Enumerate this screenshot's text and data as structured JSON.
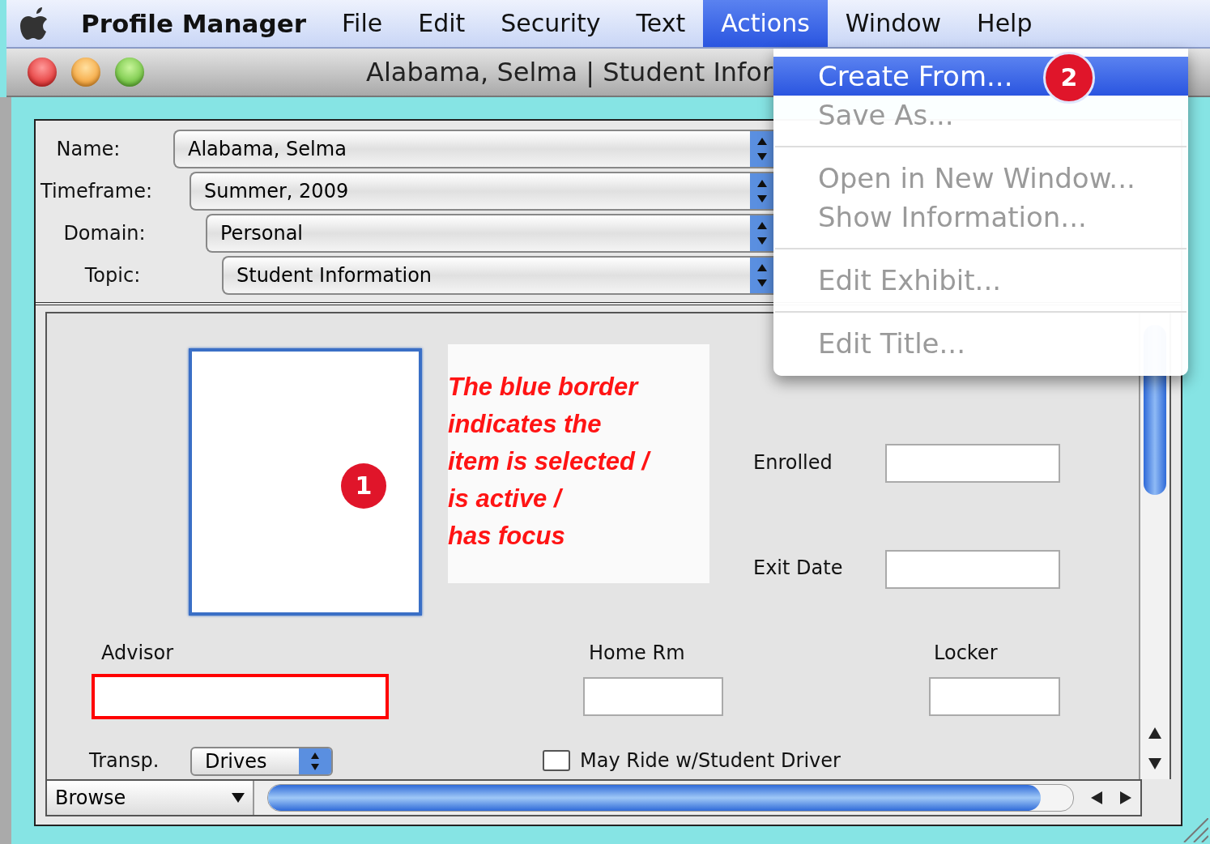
{
  "menu_bar": {
    "app_name": "Profile Manager",
    "items": [
      {
        "label": "File",
        "selected": false
      },
      {
        "label": "Edit",
        "selected": false
      },
      {
        "label": "Security",
        "selected": false
      },
      {
        "label": "Text",
        "selected": false
      },
      {
        "label": "Actions",
        "selected": true
      },
      {
        "label": "Window",
        "selected": false
      },
      {
        "label": "Help",
        "selected": false
      }
    ]
  },
  "window": {
    "title": "Alabama, Selma | Student Infor"
  },
  "header_fields": [
    {
      "label": "Name:",
      "value": "Alabama, Selma"
    },
    {
      "label": "Timeframe:",
      "value": "Summer, 2009"
    },
    {
      "label": "Domain:",
      "value": "Personal"
    },
    {
      "label": "Topic:",
      "value": "Student Information"
    }
  ],
  "photo_box": {
    "selected": true
  },
  "annotation": "The blue border\nindicates the\nitem is selected /\nis active /\nhas focus",
  "callouts": [
    "1",
    "2"
  ],
  "fields": [
    {
      "label": "Enrolled",
      "highlighted": false
    },
    {
      "label": "Exit Date",
      "highlighted": false
    },
    {
      "label": "Advisor",
      "highlighted": true
    },
    {
      "label": "Home Rm",
      "highlighted": false
    },
    {
      "label": "Locker",
      "highlighted": false
    }
  ],
  "transport": {
    "label": "Transp.",
    "value": "Drives"
  },
  "checkbox": {
    "label": "May Ride w/Student Driver",
    "checked": false
  },
  "mode_menu": {
    "value": "Browse"
  },
  "actions_menu": {
    "items": [
      {
        "kind": "item",
        "label": "Create From...",
        "selected": true,
        "disabled": false
      },
      {
        "kind": "item",
        "label": "Save As...",
        "selected": false,
        "disabled": true
      },
      {
        "kind": "separator"
      },
      {
        "kind": "item",
        "label": "Open in New Window...",
        "selected": false,
        "disabled": true
      },
      {
        "kind": "item",
        "label": "Show Information...",
        "selected": false,
        "disabled": true
      },
      {
        "kind": "separator"
      },
      {
        "kind": "item",
        "label": "Edit Exhibit...",
        "selected": false,
        "disabled": true
      },
      {
        "kind": "separator"
      },
      {
        "kind": "item",
        "label": "Edit Title...",
        "selected": false,
        "disabled": true
      }
    ]
  }
}
